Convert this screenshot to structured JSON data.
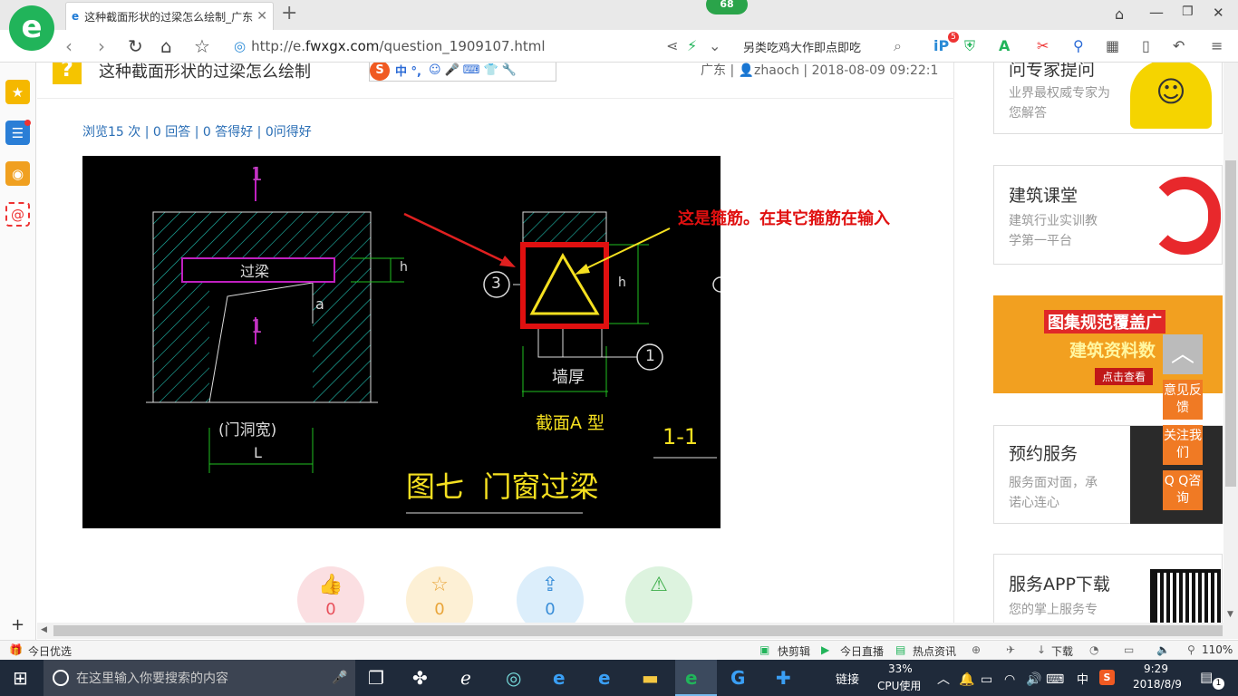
{
  "browser": {
    "badge_count": "68",
    "tab_title": "这种截面形状的过梁怎么绘制_广东",
    "new_tab_label": "+",
    "address_prefix": "http://e.",
    "address_domain": "fwxgx.com",
    "address_path": "/question_1909107.html",
    "search_hint": "另类吃鸡大作即点即吃",
    "shield_badge": "5"
  },
  "question": {
    "title": "这种截面形状的过梁怎么绘制",
    "ime_label": "中 °,",
    "meta": "广东 | 👤zhaoch | 2018-08-09 09:22:1",
    "stats": "浏览15 次 | 0 回答 | 0 答得好 | 0问得好"
  },
  "drawing": {
    "label_section": "1",
    "label_beam": "过梁",
    "label_a": "a",
    "label_h": "h",
    "label_opening": "(门洞宽)",
    "label_L": "L",
    "label_circle3": "3",
    "label_circle1": "1",
    "label_h2": "h",
    "label_wall": "墙厚",
    "label_type": "截面A 型",
    "label_11": "1-1",
    "caption": "图七  门窗过梁",
    "annotation": "这是箍筋。在其它箍筋在输入"
  },
  "votes": [
    {
      "icon": "thumbs-up",
      "count": "0",
      "color": "#fbdfe2",
      "fg": "#e8505b"
    },
    {
      "icon": "star",
      "count": "0",
      "color": "#fdf0d5",
      "fg": "#e9a53a"
    },
    {
      "icon": "share",
      "count": "0",
      "color": "#dceefb",
      "fg": "#3a8ed8"
    },
    {
      "icon": "warning",
      "count": "",
      "color": "#ddf3df",
      "fg": "#3fae4b"
    }
  ],
  "right": {
    "expert_title": "问专家提问",
    "expert_sub": "业界最权威专家为您解答",
    "class_title": "建筑课堂",
    "class_sub1": "建筑行业实训教",
    "class_sub2": "学第一平台",
    "banner_line1": "图集规范覆盖广",
    "banner_line2": "建筑资料数",
    "banner_btn": "点击查看",
    "service_title": "预约服务",
    "service_sub1": "服务面对面，承",
    "service_sub2": "诺心连心",
    "app_title": "服务APP下载",
    "app_sub": "您的掌上服务专"
  },
  "float": {
    "feedback": "意见反馈",
    "follow": "关注我们",
    "qq": "Q Q咨询"
  },
  "status": {
    "today": "今日优选",
    "cut": "快剪辑",
    "live": "今日直播",
    "news": "热点资讯",
    "download": "下载",
    "zoom": "110%"
  },
  "taskbar": {
    "search_placeholder": "在这里输入你要搜索的内容",
    "link": "链接",
    "cpu_pct": "33%",
    "cpu_label": "CPU使用",
    "lang": "中",
    "time": "9:29",
    "date": "2018/8/9",
    "notif": "1"
  }
}
